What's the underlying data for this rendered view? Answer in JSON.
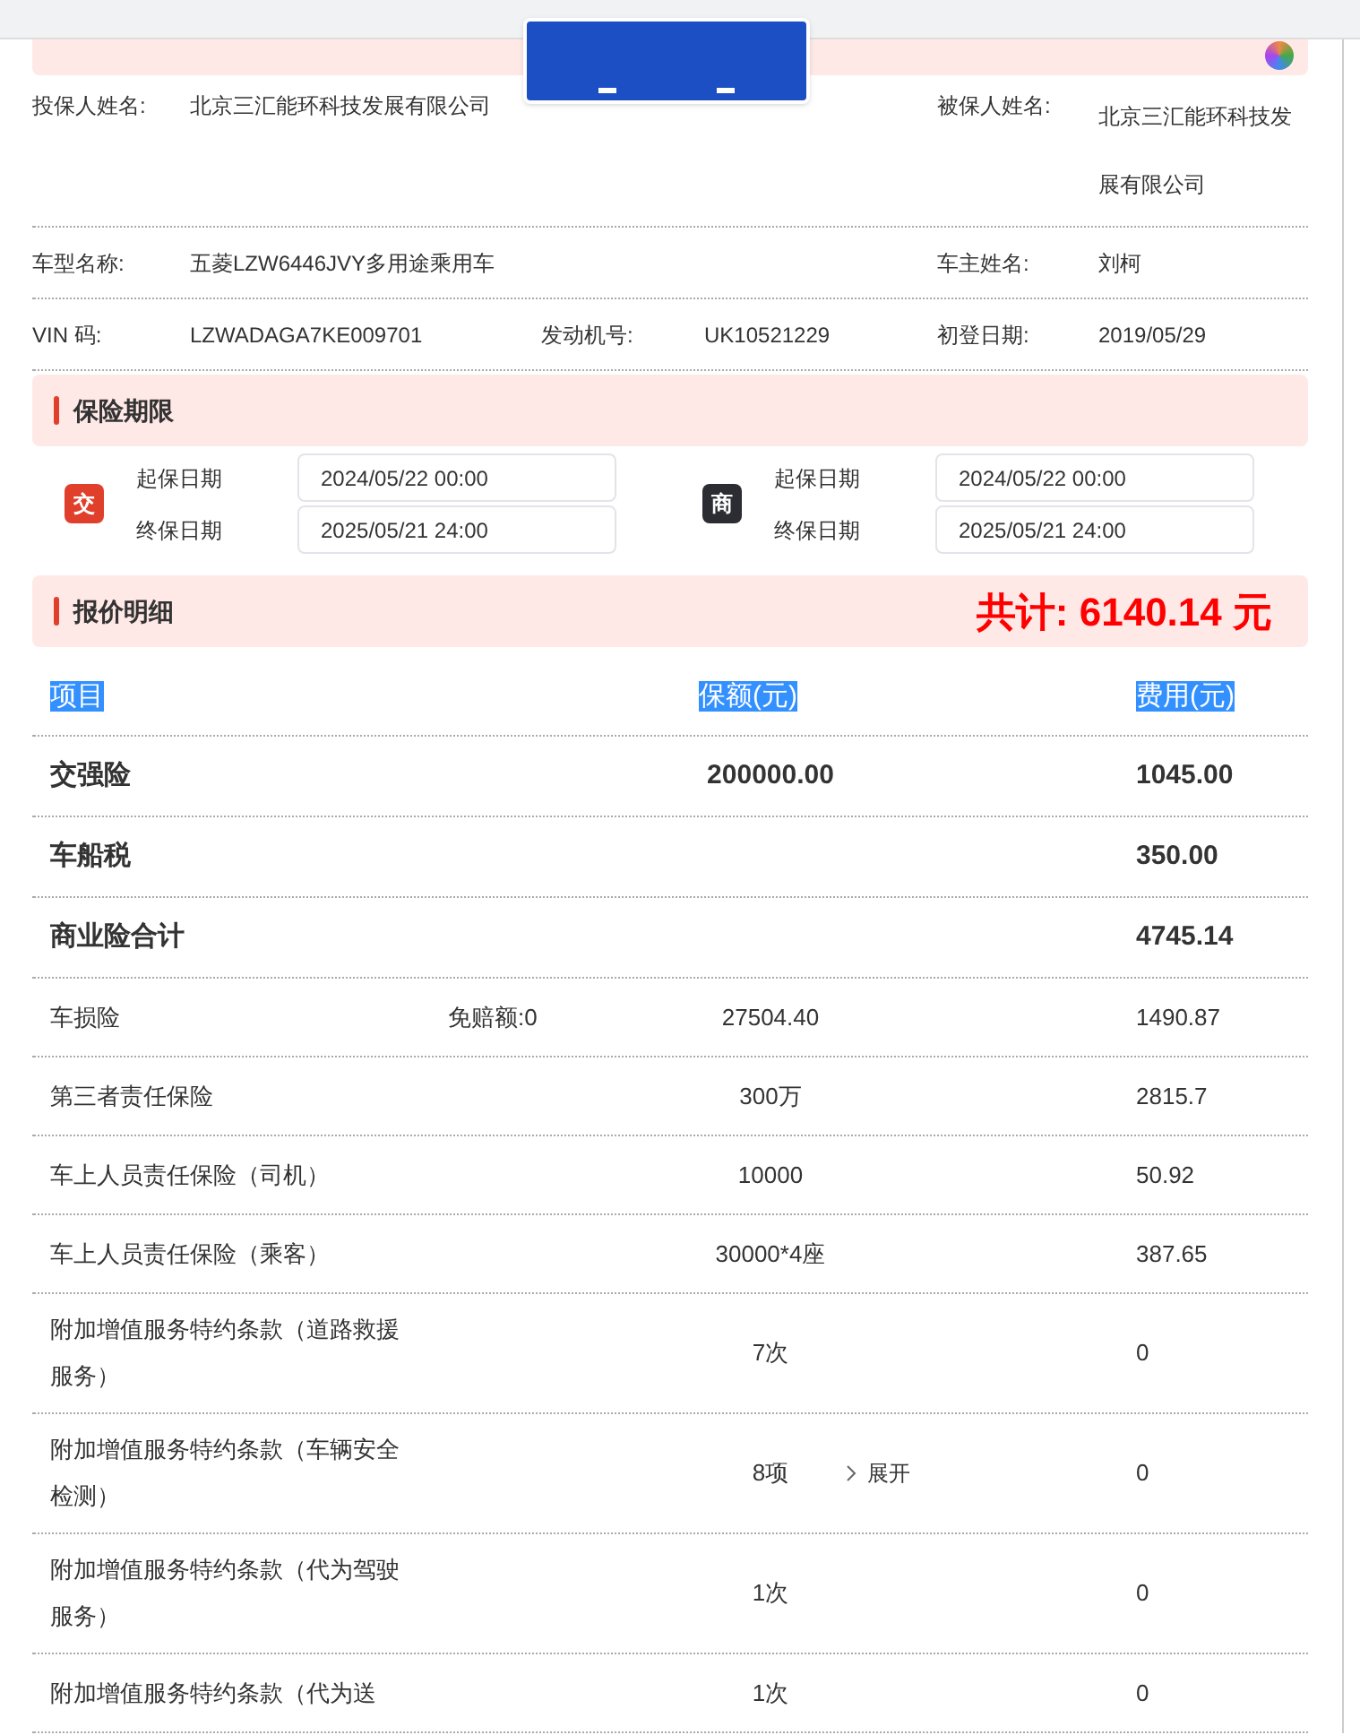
{
  "owner_info": [
    {
      "label": "投保人姓名:",
      "value": "北京三汇能环科技发展有限公司",
      "label2": "被保人姓名:",
      "value2": "北京三汇能环科技发展有限公司"
    },
    {
      "label": "车型名称:",
      "value": "五菱LZW6446JVY多用途乘用车",
      "label2": "车主姓名:",
      "value2": "刘柯"
    },
    {
      "label": "VIN 码:",
      "value": "LZWADAGA7KE009701",
      "label_mid": "发动机号:",
      "value_mid": "UK10521229",
      "label2": "初登日期:",
      "value2": "2019/05/29"
    }
  ],
  "period": {
    "title": "保险期限",
    "groups": [
      {
        "badge": "交",
        "kind": "compulsory",
        "start_label": "起保日期",
        "start": "2024/05/22 00:00",
        "end_label": "终保日期",
        "end": "2025/05/21 24:00"
      },
      {
        "badge": "商",
        "kind": "commercial",
        "start_label": "起保日期",
        "start": "2024/05/22 00:00",
        "end_label": "终保日期",
        "end": "2025/05/21 24:00"
      }
    ]
  },
  "quote": {
    "title": "报价明细",
    "total": "共计: 6140.14 元",
    "columns": [
      "项目",
      "保额(元)",
      "费用(元)"
    ],
    "rows": [
      {
        "kind": "summary",
        "item": "交强险",
        "amount": "200000.00",
        "fee": "1045.00"
      },
      {
        "kind": "summary",
        "item": "车船税",
        "fee": "350.00"
      },
      {
        "kind": "summary",
        "item": "商业险合计",
        "fee": "4745.14"
      },
      {
        "kind": "detail",
        "item": "车损险",
        "note": "免赔额:0",
        "amount": "27504.40",
        "fee": "1490.87"
      },
      {
        "kind": "detail",
        "item": "第三者责任保险",
        "amount": "300万",
        "fee": "2815.7"
      },
      {
        "kind": "detail",
        "item": "车上人员责任保险（司机）",
        "amount": "10000",
        "fee": "50.92"
      },
      {
        "kind": "detail",
        "item": "车上人员责任保险（乘客）",
        "amount": "30000*4座",
        "fee": "387.65"
      },
      {
        "kind": "detail",
        "item": "附加增值服务特约条款（道路救援服务）",
        "amount": "7次",
        "fee": "0"
      },
      {
        "kind": "detail",
        "item": "附加增值服务特约条款（车辆安全检测）",
        "amount": "8项",
        "expand": "展开",
        "fee": "0"
      },
      {
        "kind": "detail",
        "item": "附加增值服务特约条款（代为驾驶服务）",
        "amount": "1次",
        "fee": "0"
      },
      {
        "kind": "detail",
        "item": "附加增值服务特约条款（代为送",
        "amount": "1次",
        "fee": "0"
      }
    ]
  }
}
